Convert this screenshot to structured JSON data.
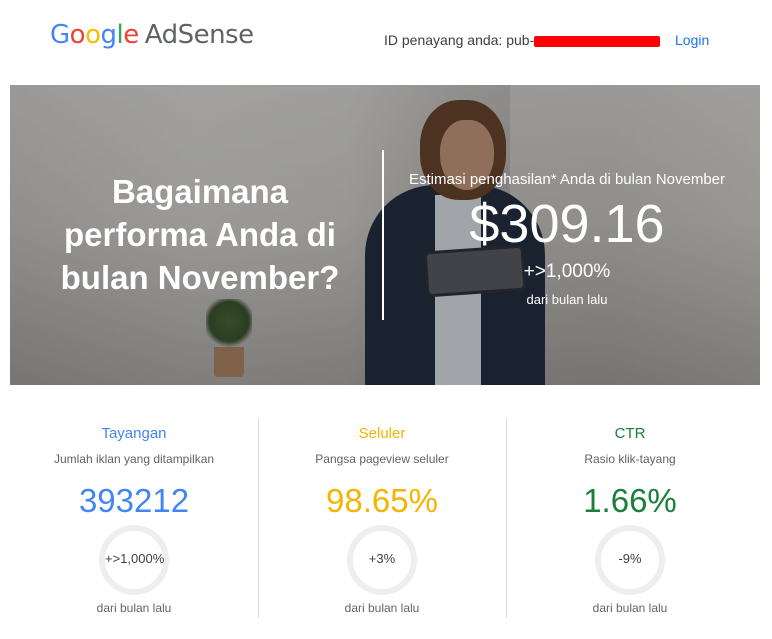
{
  "header": {
    "logo_google": "Google",
    "logo_product": "AdSense",
    "publisher_label": "ID penayang anda: pub-",
    "login_label": "Login"
  },
  "hero": {
    "headline": "Bagaimana performa Anda di bulan November?",
    "estimate_label": "Estimasi penghasilan* Anda di bulan November",
    "estimate_value": "$309.16",
    "estimate_change": "+>1,000%",
    "estimate_sub": "dari bulan lalu"
  },
  "metrics": [
    {
      "title": "Tayangan",
      "description": "Jumlah iklan yang ditampilkan",
      "value": "393212",
      "change": "+>1,000%",
      "footer": "dari bulan lalu",
      "color": "#4285f4"
    },
    {
      "title": "Seluler",
      "description": "Pangsa pageview seluler",
      "value": "98.65%",
      "change": "+3%",
      "footer": "dari bulan lalu",
      "color": "#f4b400"
    },
    {
      "title": "CTR",
      "description": "Rasio klik-tayang",
      "value": "1.66%",
      "change": "-9%",
      "footer": "dari bulan lalu",
      "color": "#188038"
    }
  ],
  "colors": {
    "accent_link": "#1a73e8",
    "redaction": "#ff0000"
  },
  "icons": {
    "logo": "google-adsense-logo"
  }
}
